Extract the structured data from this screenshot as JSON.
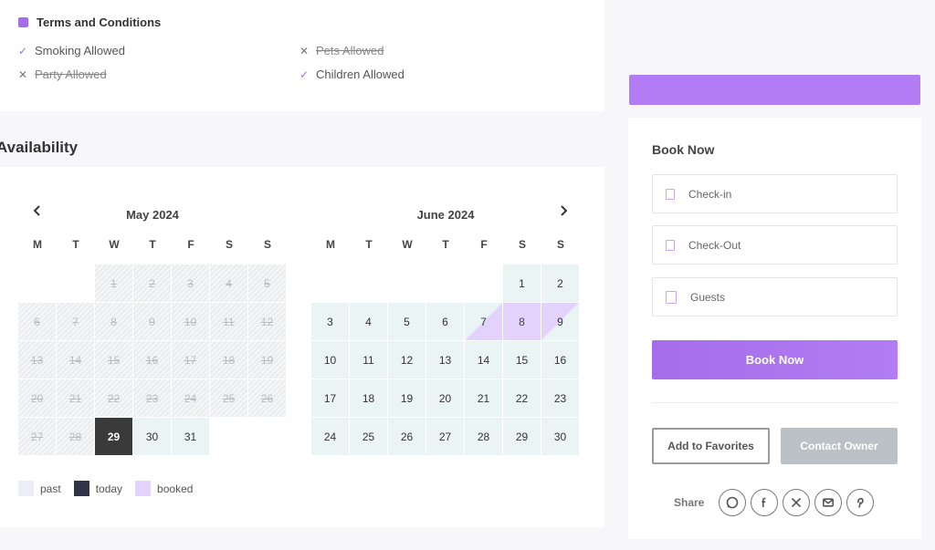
{
  "terms": {
    "title": "Terms and Conditions",
    "rules": [
      {
        "label": "Smoking Allowed",
        "allowed": true
      },
      {
        "label": "Pets Allowed",
        "allowed": false
      },
      {
        "label": "Party Allowed",
        "allowed": false
      },
      {
        "label": "Children Allowed",
        "allowed": true
      }
    ],
    "check_icon": "✓",
    "cross_icon": "✕"
  },
  "availability": {
    "title": "Availability",
    "weekdays": [
      "M",
      "T",
      "W",
      "T",
      "F",
      "S",
      "S"
    ],
    "months": [
      {
        "title": "May 2024",
        "days": [
          {
            "d": "",
            "s": "empty"
          },
          {
            "d": "",
            "s": "empty"
          },
          {
            "d": "1",
            "s": "past"
          },
          {
            "d": "2",
            "s": "past"
          },
          {
            "d": "3",
            "s": "past"
          },
          {
            "d": "4",
            "s": "past"
          },
          {
            "d": "5",
            "s": "past"
          },
          {
            "d": "6",
            "s": "past"
          },
          {
            "d": "7",
            "s": "past"
          },
          {
            "d": "8",
            "s": "past"
          },
          {
            "d": "9",
            "s": "past"
          },
          {
            "d": "10",
            "s": "past"
          },
          {
            "d": "11",
            "s": "past"
          },
          {
            "d": "12",
            "s": "past"
          },
          {
            "d": "13",
            "s": "past"
          },
          {
            "d": "14",
            "s": "past"
          },
          {
            "d": "15",
            "s": "past"
          },
          {
            "d": "16",
            "s": "past"
          },
          {
            "d": "17",
            "s": "past"
          },
          {
            "d": "18",
            "s": "past"
          },
          {
            "d": "19",
            "s": "past"
          },
          {
            "d": "20",
            "s": "past"
          },
          {
            "d": "21",
            "s": "past"
          },
          {
            "d": "22",
            "s": "past"
          },
          {
            "d": "23",
            "s": "past"
          },
          {
            "d": "24",
            "s": "past"
          },
          {
            "d": "25",
            "s": "past"
          },
          {
            "d": "26",
            "s": "past"
          },
          {
            "d": "27",
            "s": "past"
          },
          {
            "d": "28",
            "s": "past"
          },
          {
            "d": "29",
            "s": "today"
          },
          {
            "d": "30",
            "s": "avail"
          },
          {
            "d": "31",
            "s": "avail"
          }
        ]
      },
      {
        "title": "June 2024",
        "days": [
          {
            "d": "",
            "s": "empty"
          },
          {
            "d": "",
            "s": "empty"
          },
          {
            "d": "",
            "s": "empty"
          },
          {
            "d": "",
            "s": "empty"
          },
          {
            "d": "",
            "s": "empty"
          },
          {
            "d": "1",
            "s": "avail"
          },
          {
            "d": "2",
            "s": "avail"
          },
          {
            "d": "3",
            "s": "avail"
          },
          {
            "d": "4",
            "s": "avail"
          },
          {
            "d": "5",
            "s": "avail"
          },
          {
            "d": "6",
            "s": "avail"
          },
          {
            "d": "7",
            "s": "booked-in"
          },
          {
            "d": "8",
            "s": "booked"
          },
          {
            "d": "9",
            "s": "booked-out"
          },
          {
            "d": "10",
            "s": "avail"
          },
          {
            "d": "11",
            "s": "avail"
          },
          {
            "d": "12",
            "s": "avail"
          },
          {
            "d": "13",
            "s": "avail"
          },
          {
            "d": "14",
            "s": "avail"
          },
          {
            "d": "15",
            "s": "avail"
          },
          {
            "d": "16",
            "s": "avail"
          },
          {
            "d": "17",
            "s": "avail"
          },
          {
            "d": "18",
            "s": "avail"
          },
          {
            "d": "19",
            "s": "avail"
          },
          {
            "d": "20",
            "s": "avail"
          },
          {
            "d": "21",
            "s": "avail"
          },
          {
            "d": "22",
            "s": "avail"
          },
          {
            "d": "23",
            "s": "avail"
          },
          {
            "d": "24",
            "s": "avail"
          },
          {
            "d": "25",
            "s": "avail"
          },
          {
            "d": "26",
            "s": "avail"
          },
          {
            "d": "27",
            "s": "avail"
          },
          {
            "d": "28",
            "s": "avail"
          },
          {
            "d": "29",
            "s": "avail"
          },
          {
            "d": "30",
            "s": "avail"
          }
        ]
      }
    ],
    "legend": [
      {
        "label": "past",
        "color": "#ebeef4"
      },
      {
        "label": "today",
        "color": "#2f3544"
      },
      {
        "label": "booked",
        "color": "#e3d2fb"
      }
    ]
  },
  "booking": {
    "title": "Book Now",
    "checkin_placeholder": "Check-in",
    "checkout_placeholder": "Check-Out",
    "guests_placeholder": "Guests",
    "book_button": "Book Now",
    "favorites_button": "Add to Favorites",
    "contact_button": "Contact Owner",
    "share_label": "Share",
    "share_icons": [
      "whatsapp-icon",
      "facebook-icon",
      "x-icon",
      "email-icon",
      "pinterest-icon"
    ]
  },
  "colors": {
    "accent": "#a56ee8",
    "accent_light": "#b27cf5",
    "available": "#ebf4f4",
    "booked": "#e3d2fb",
    "today": "#3a3a3a"
  }
}
